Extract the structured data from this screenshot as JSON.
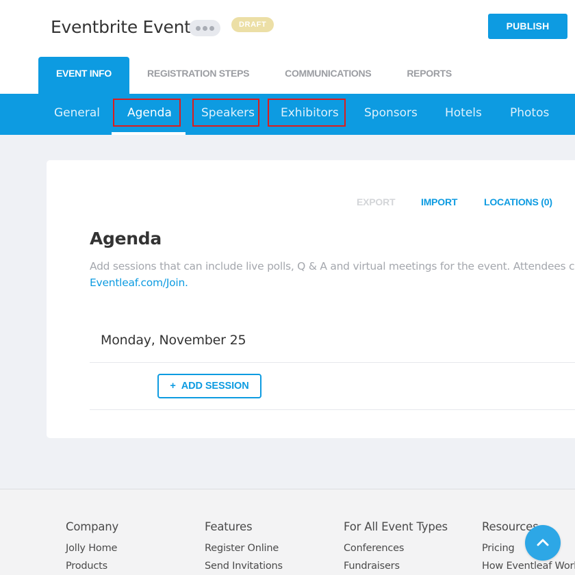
{
  "header": {
    "event_title": "Eventbrite Event",
    "draft_badge": "DRAFT",
    "publish_label": "PUBLISH",
    "more_icon": "ellipsis-icon"
  },
  "main_tabs": [
    {
      "label": "EVENT INFO",
      "active": true
    },
    {
      "label": "REGISTRATION STEPS",
      "active": false
    },
    {
      "label": "COMMUNICATIONS",
      "active": false
    },
    {
      "label": "REPORTS",
      "active": false
    }
  ],
  "subnav": [
    {
      "label": "General",
      "active": false
    },
    {
      "label": "Agenda",
      "active": true
    },
    {
      "label": "Speakers",
      "active": false
    },
    {
      "label": "Exhibitors",
      "active": false
    },
    {
      "label": "Sponsors",
      "active": false
    },
    {
      "label": "Hotels",
      "active": false
    },
    {
      "label": "Photos",
      "active": false
    }
  ],
  "card": {
    "export_label": "EXPORT",
    "import_label": "IMPORT",
    "locations_label": "LOCATIONS (0)",
    "title": "Agenda",
    "description": "Add sessions that can include live polls, Q & A and virtual meetings for the event. Attendees c",
    "link": "Eventleaf.com/Join.",
    "day_label": "Monday, November 25",
    "add_session_label": "ADD SESSION",
    "add_session_icon": "+"
  },
  "footer": {
    "columns": [
      {
        "heading": "Company",
        "links": [
          "Jolly Home",
          "Products"
        ]
      },
      {
        "heading": "Features",
        "links": [
          "Register Online",
          "Send Invitations"
        ]
      },
      {
        "heading": "For All Event Types",
        "links": [
          "Conferences",
          "Fundraisers"
        ]
      },
      {
        "heading": "Resources",
        "links": [
          "Pricing",
          "How Eventleaf Work"
        ]
      }
    ],
    "scroll_top_icon": "chevron-up-icon"
  },
  "colors": {
    "accent": "#0d9be1",
    "draft_badge": "#ecdfa6",
    "highlight_box": "#dd1c1c"
  }
}
